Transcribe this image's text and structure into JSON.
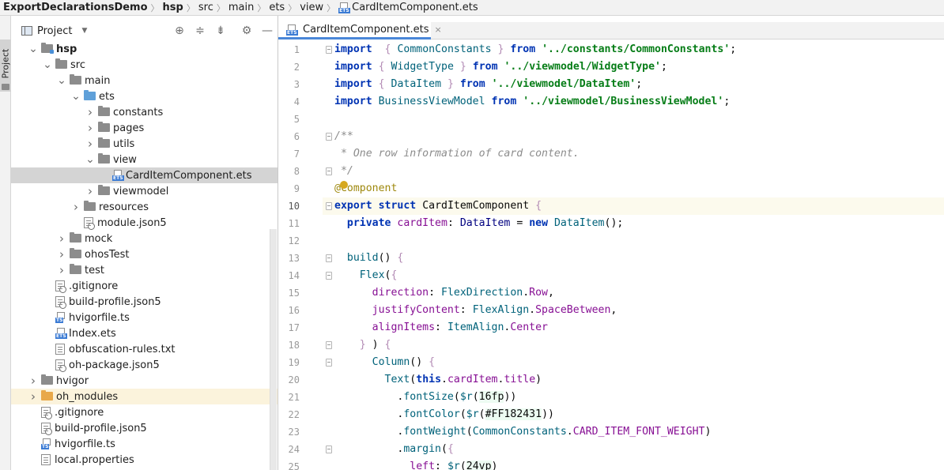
{
  "breadcrumb": {
    "items": [
      "ExportDeclarationsDemo",
      "hsp",
      "src",
      "main",
      "ets",
      "view",
      "CardItemComponent.ets"
    ]
  },
  "toolstrip": {
    "project_tab_label": "Project"
  },
  "project_panel": {
    "title": "Project",
    "dropdown_icon": "chevron-down-icon",
    "header_buttons": [
      "locate-icon",
      "expand-all-icon",
      "collapse-all-icon",
      "gear-icon",
      "minimize-icon"
    ],
    "tree": [
      {
        "label": "hsp",
        "depth": 1,
        "arrow": "expanded",
        "icon": "module-folder",
        "bold": true
      },
      {
        "label": "src",
        "depth": 2,
        "arrow": "expanded",
        "icon": "folder"
      },
      {
        "label": "main",
        "depth": 3,
        "arrow": "expanded",
        "icon": "folder"
      },
      {
        "label": "ets",
        "depth": 4,
        "arrow": "expanded",
        "icon": "folder-blue"
      },
      {
        "label": "constants",
        "depth": 5,
        "arrow": "collapsed",
        "icon": "folder"
      },
      {
        "label": "pages",
        "depth": 5,
        "arrow": "collapsed",
        "icon": "folder"
      },
      {
        "label": "utils",
        "depth": 5,
        "arrow": "collapsed",
        "icon": "folder"
      },
      {
        "label": "view",
        "depth": 5,
        "arrow": "expanded",
        "icon": "folder"
      },
      {
        "label": "CardItemComponent.ets",
        "depth": 6,
        "arrow": "none",
        "icon": "ets-file",
        "selected": true
      },
      {
        "label": "viewmodel",
        "depth": 5,
        "arrow": "collapsed",
        "icon": "folder"
      },
      {
        "label": "resources",
        "depth": 4,
        "arrow": "collapsed",
        "icon": "folder"
      },
      {
        "label": "module.json5",
        "depth": 4,
        "arrow": "none",
        "icon": "json-file"
      },
      {
        "label": "mock",
        "depth": 3,
        "arrow": "collapsed",
        "icon": "folder"
      },
      {
        "label": "ohosTest",
        "depth": 3,
        "arrow": "collapsed",
        "icon": "folder"
      },
      {
        "label": "test",
        "depth": 3,
        "arrow": "collapsed",
        "icon": "folder"
      },
      {
        "label": ".gitignore",
        "depth": 2,
        "arrow": "none",
        "icon": "ignore-file"
      },
      {
        "label": "build-profile.json5",
        "depth": 2,
        "arrow": "none",
        "icon": "json-file"
      },
      {
        "label": "hvigorfile.ts",
        "depth": 2,
        "arrow": "none",
        "icon": "ts-file"
      },
      {
        "label": "Index.ets",
        "depth": 2,
        "arrow": "none",
        "icon": "ets-file"
      },
      {
        "label": "obfuscation-rules.txt",
        "depth": 2,
        "arrow": "none",
        "icon": "text-file"
      },
      {
        "label": "oh-package.json5",
        "depth": 2,
        "arrow": "none",
        "icon": "json-file"
      },
      {
        "label": "hvigor",
        "depth": 1,
        "arrow": "collapsed",
        "icon": "folder"
      },
      {
        "label": "oh_modules",
        "depth": 1,
        "arrow": "collapsed",
        "icon": "folder-orange",
        "highlight": true
      },
      {
        "label": ".gitignore",
        "depth": 1,
        "arrow": "none",
        "icon": "ignore-file"
      },
      {
        "label": "build-profile.json5",
        "depth": 1,
        "arrow": "none",
        "icon": "json-file"
      },
      {
        "label": "hvigorfile.ts",
        "depth": 1,
        "arrow": "none",
        "icon": "ts-file"
      },
      {
        "label": "local.properties",
        "depth": 1,
        "arrow": "none",
        "icon": "properties-file"
      }
    ]
  },
  "editor": {
    "tab_label": "CardItemComponent.ets",
    "tab_close": "×",
    "current_line": 10,
    "lines": [
      [
        [
          "kw",
          "import"
        ],
        [
          "",
          "  "
        ],
        [
          "br",
          "{"
        ],
        [
          "",
          " "
        ],
        [
          "id",
          "CommonConstants"
        ],
        [
          "",
          " "
        ],
        [
          "br",
          "}"
        ],
        [
          "",
          " "
        ],
        [
          "kw",
          "from"
        ],
        [
          "",
          " "
        ],
        [
          "str",
          "'../constants/CommonConstants'"
        ],
        [
          "",
          ";"
        ]
      ],
      [
        [
          "kw",
          "import"
        ],
        [
          "",
          " "
        ],
        [
          "br",
          "{"
        ],
        [
          "",
          " "
        ],
        [
          "id",
          "WidgetType"
        ],
        [
          "",
          " "
        ],
        [
          "br",
          "}"
        ],
        [
          "",
          " "
        ],
        [
          "kw",
          "from"
        ],
        [
          "",
          " "
        ],
        [
          "str",
          "'../viewmodel/WidgetType'"
        ],
        [
          "",
          ";"
        ]
      ],
      [
        [
          "kw",
          "import"
        ],
        [
          "",
          " "
        ],
        [
          "br",
          "{"
        ],
        [
          "",
          " "
        ],
        [
          "id",
          "DataItem"
        ],
        [
          "",
          " "
        ],
        [
          "br",
          "}"
        ],
        [
          "",
          " "
        ],
        [
          "kw",
          "from"
        ],
        [
          "",
          " "
        ],
        [
          "str",
          "'../viewmodel/DataItem'"
        ],
        [
          "",
          ";"
        ]
      ],
      [
        [
          "kw",
          "import"
        ],
        [
          "",
          " "
        ],
        [
          "id",
          "BusinessViewModel"
        ],
        [
          "",
          " "
        ],
        [
          "kw",
          "from"
        ],
        [
          "",
          " "
        ],
        [
          "str",
          "'../viewmodel/BusinessViewModel'"
        ],
        [
          "",
          ";"
        ]
      ],
      [
        [
          "",
          ""
        ]
      ],
      [
        [
          "cm",
          "/**"
        ]
      ],
      [
        [
          "cm",
          " * One row information of card content."
        ]
      ],
      [
        [
          "cm",
          " */"
        ]
      ],
      [
        [
          "ann",
          "@Component"
        ]
      ],
      [
        [
          "kw",
          "export"
        ],
        [
          "",
          " "
        ],
        [
          "kw",
          "struct"
        ],
        [
          "",
          " "
        ],
        [
          "",
          "CardItemComponent"
        ],
        [
          "",
          " "
        ],
        [
          "br",
          "{"
        ]
      ],
      [
        [
          "",
          "  "
        ],
        [
          "kw",
          "private"
        ],
        [
          "",
          " "
        ],
        [
          "prop",
          "cardItem"
        ],
        [
          "",
          ": "
        ],
        [
          "type",
          "DataItem"
        ],
        [
          "",
          " = "
        ],
        [
          "kw",
          "new"
        ],
        [
          "",
          " "
        ],
        [
          "fn",
          "DataItem"
        ],
        [
          "",
          "();"
        ]
      ],
      [
        [
          "",
          ""
        ]
      ],
      [
        [
          "",
          "  "
        ],
        [
          "fn",
          "build"
        ],
        [
          "",
          "() "
        ],
        [
          "br",
          "{"
        ]
      ],
      [
        [
          "",
          "    "
        ],
        [
          "fn",
          "Flex"
        ],
        [
          "",
          "("
        ],
        [
          "br",
          "{"
        ]
      ],
      [
        [
          "",
          "      "
        ],
        [
          "prop",
          "direction"
        ],
        [
          "",
          ": "
        ],
        [
          "id",
          "FlexDirection"
        ],
        [
          "",
          "."
        ],
        [
          "prop",
          "Row"
        ],
        [
          "",
          ","
        ]
      ],
      [
        [
          "",
          "      "
        ],
        [
          "prop",
          "justifyContent"
        ],
        [
          "",
          ": "
        ],
        [
          "id",
          "FlexAlign"
        ],
        [
          "",
          "."
        ],
        [
          "prop",
          "SpaceBetween"
        ],
        [
          "",
          ","
        ]
      ],
      [
        [
          "",
          "      "
        ],
        [
          "prop",
          "alignItems"
        ],
        [
          "",
          ": "
        ],
        [
          "id",
          "ItemAlign"
        ],
        [
          "",
          "."
        ],
        [
          "prop",
          "Center"
        ]
      ],
      [
        [
          "",
          "    "
        ],
        [
          "br",
          "}"
        ],
        [
          "",
          " ) "
        ],
        [
          "br",
          "{"
        ]
      ],
      [
        [
          "",
          "      "
        ],
        [
          "fn",
          "Column"
        ],
        [
          "",
          "() "
        ],
        [
          "br",
          "{"
        ]
      ],
      [
        [
          "",
          "        "
        ],
        [
          "fn",
          "Text"
        ],
        [
          "",
          "("
        ],
        [
          "kw",
          "this"
        ],
        [
          "",
          "."
        ],
        [
          "prop",
          "cardItem"
        ],
        [
          "",
          "."
        ],
        [
          "prop",
          "title"
        ],
        [
          "",
          ")"
        ]
      ],
      [
        [
          "",
          "          ."
        ],
        [
          "fn",
          "fontSize"
        ],
        [
          "",
          "("
        ],
        [
          "fn",
          "$r"
        ],
        [
          "",
          "("
        ],
        [
          "num",
          "16fp"
        ],
        [
          "",
          "))"
        ]
      ],
      [
        [
          "",
          "          ."
        ],
        [
          "fn",
          "fontColor"
        ],
        [
          "",
          "("
        ],
        [
          "fn",
          "$r"
        ],
        [
          "",
          "("
        ],
        [
          "num",
          "#FF182431"
        ],
        [
          "",
          "))"
        ]
      ],
      [
        [
          "",
          "          ."
        ],
        [
          "fn",
          "fontWeight"
        ],
        [
          "",
          "("
        ],
        [
          "id",
          "CommonConstants"
        ],
        [
          "",
          "."
        ],
        [
          "prop",
          "CARD_ITEM_FONT_WEIGHT"
        ],
        [
          "",
          ")"
        ]
      ],
      [
        [
          "",
          "          ."
        ],
        [
          "fn",
          "margin"
        ],
        [
          "",
          "("
        ],
        [
          "br",
          "{"
        ]
      ],
      [
        [
          "",
          "            "
        ],
        [
          "prop",
          "left"
        ],
        [
          "",
          ": "
        ],
        [
          "fn",
          "$r"
        ],
        [
          "",
          "("
        ],
        [
          "num",
          "24vp"
        ],
        [
          "",
          ")"
        ]
      ]
    ]
  }
}
